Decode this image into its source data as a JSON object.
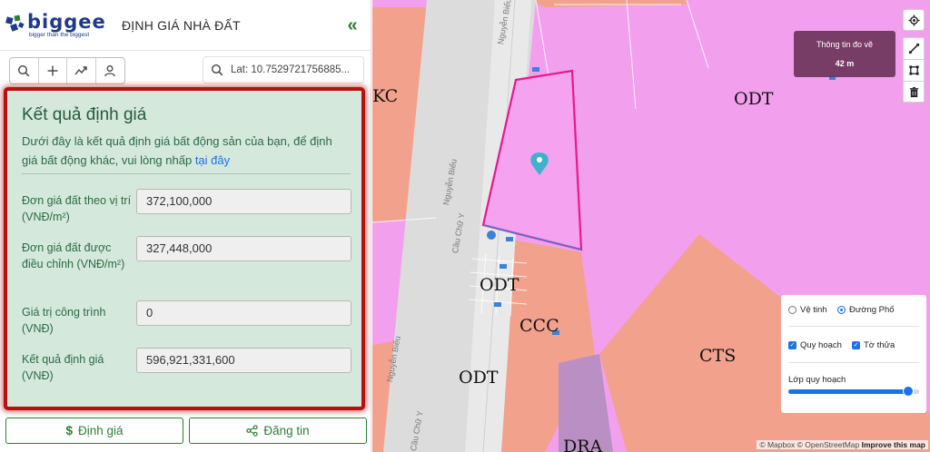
{
  "app": {
    "logo_text": "biggee",
    "logo_tagline": "bigger than the biggest",
    "title": "ĐỊNH GIÁ NHÀ ĐẤT",
    "collapse_icon": "«"
  },
  "toolbar": {
    "icons": [
      "search-icon",
      "plus-icon",
      "trend-icon",
      "user-icon"
    ]
  },
  "coordinate_search": {
    "icon": "search-icon",
    "value": "Lat: 10.7529721756885..."
  },
  "result": {
    "title": "Kết quả định giá",
    "description": "Dưới đây là kết quả định giá bất động sản của bạn, để định giá bất động khác, vui lòng nhấp ",
    "link_text": "tại đây",
    "fields": [
      {
        "label": "Đơn giá đất theo vị trí (VNĐ/m²)",
        "value": "372,100,000"
      },
      {
        "label": "Đơn giá đất được điều chỉnh (VNĐ/m²)",
        "value": "327,448,000"
      },
      {
        "label": "Giá trị công trình (VNĐ)",
        "value": "0"
      },
      {
        "label": "Kết quả định giá (VNĐ)",
        "value": "596,921,331,600"
      }
    ]
  },
  "actions": {
    "valuate_icon": "$",
    "valuate_label": "Định giá",
    "post_icon": "share-icon",
    "post_label": "Đăng tin"
  },
  "map": {
    "zones": [
      "KC",
      "ODT",
      "ODT",
      "CCC",
      "ODT",
      "CTS",
      "DRA"
    ],
    "streets": [
      "Nguyễn Biểu",
      "Nguyễn Biểu",
      "Cầu Chữ Y",
      "Nguyễn Biểu",
      "Cầu Chữ Y"
    ],
    "measure": {
      "title": "Thông tin đo vẽ",
      "value": "42 m"
    },
    "layers": {
      "satellite_label": "Vệ tinh",
      "street_label": "Đường Phố",
      "selected_base": "Đường Phố",
      "planning_label": "Quy hoạch",
      "planning_checked": true,
      "parcel_label": "Tờ thửa",
      "parcel_checked": true,
      "opacity_label": "Lớp quy hoạch",
      "opacity_level": 0.9
    },
    "attribution": {
      "mapbox": "© Mapbox",
      "osm": "© OpenStreetMap",
      "improve": "Improve this map"
    },
    "colors": {
      "residential": "#f5a3f0",
      "commercial": "#f2a18d",
      "road": "#d6d6d6",
      "selected_parcel": "#e8198a",
      "pin": "#3fb1cc"
    }
  }
}
